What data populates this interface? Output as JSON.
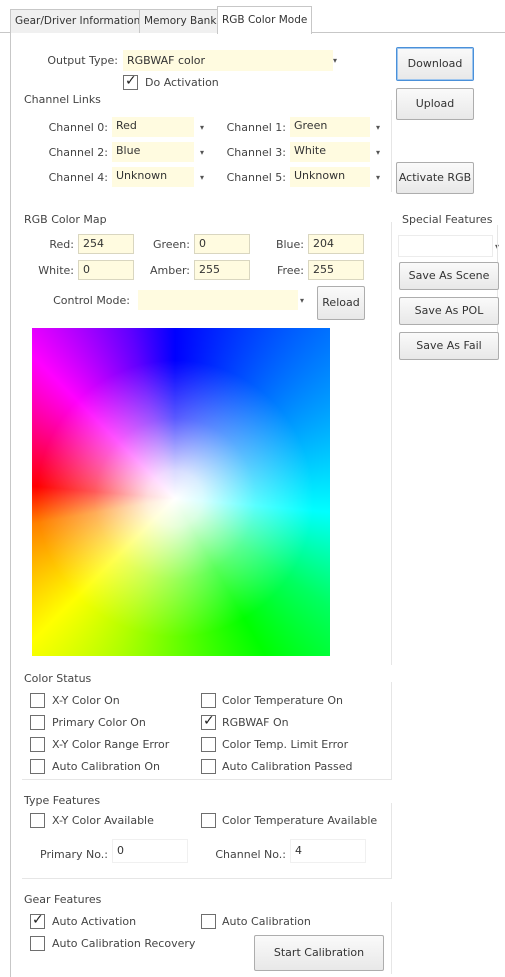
{
  "tabs": [
    {
      "label": "Gear/Driver Information"
    },
    {
      "label": "Memory Bank"
    },
    {
      "label": "RGB Color Mode"
    }
  ],
  "output": {
    "label": "Output Type:",
    "value": "RGBWAF color",
    "do_activation_label": "Do Activation",
    "do_activation_checked": true
  },
  "channel_links": {
    "title": "Channel Links",
    "channels": [
      {
        "label": "Channel 0:",
        "value": "Red"
      },
      {
        "label": "Channel 1:",
        "value": "Green"
      },
      {
        "label": "Channel 2:",
        "value": "Blue"
      },
      {
        "label": "Channel 3:",
        "value": "White"
      },
      {
        "label": "Channel 4:",
        "value": "Unknown"
      },
      {
        "label": "Channel 5:",
        "value": "Unknown"
      }
    ]
  },
  "rgb_color_map": {
    "title": "RGB Color Map",
    "red_label": "Red:",
    "red_value": "254",
    "green_label": "Green:",
    "green_value": "0",
    "blue_label": "Blue:",
    "blue_value": "204",
    "white_label": "White:",
    "white_value": "0",
    "amber_label": "Amber:",
    "amber_value": "255",
    "free_label": "Free:",
    "free_value": "255",
    "control_mode_label": "Control Mode:",
    "control_mode_value": "",
    "reload_label": "Reload"
  },
  "side_buttons": {
    "download": "Download",
    "upload": "Upload",
    "activate_rgb": "Activate RGB"
  },
  "special_features": {
    "title": "Special Features",
    "value": "",
    "save_scene": "Save As Scene",
    "save_pol": "Save As POL",
    "save_fail": "Save As Fail"
  },
  "color_status": {
    "title": "Color Status",
    "items": [
      {
        "label": "X-Y Color On",
        "checked": false
      },
      {
        "label": "Color Temperature On",
        "checked": false
      },
      {
        "label": "Primary Color On",
        "checked": false
      },
      {
        "label": "RGBWAF On",
        "checked": true
      },
      {
        "label": "X-Y Color Range Error",
        "checked": false
      },
      {
        "label": "Color Temp. Limit Error",
        "checked": false
      },
      {
        "label": "Auto Calibration On",
        "checked": false
      },
      {
        "label": "Auto Calibration Passed",
        "checked": false
      }
    ]
  },
  "type_features": {
    "title": "Type Features",
    "xy_available": "X-Y Color Available",
    "ct_available": "Color Temperature Available",
    "primary_label": "Primary No.:",
    "primary_value": "0",
    "channel_label": "Channel No.:",
    "channel_value": "4"
  },
  "gear_features": {
    "title": "Gear Features",
    "auto_activation": "Auto Activation",
    "auto_activation_checked": true,
    "auto_calibration": "Auto Calibration",
    "auto_calibration_checked": false,
    "auto_calibration_recovery": "Auto Calibration Recovery",
    "auto_calibration_recovery_checked": false,
    "start_calibration": "Start Calibration"
  },
  "icons": {
    "dropdown": "chevron-down-icon",
    "check": "checkmark-icon"
  }
}
